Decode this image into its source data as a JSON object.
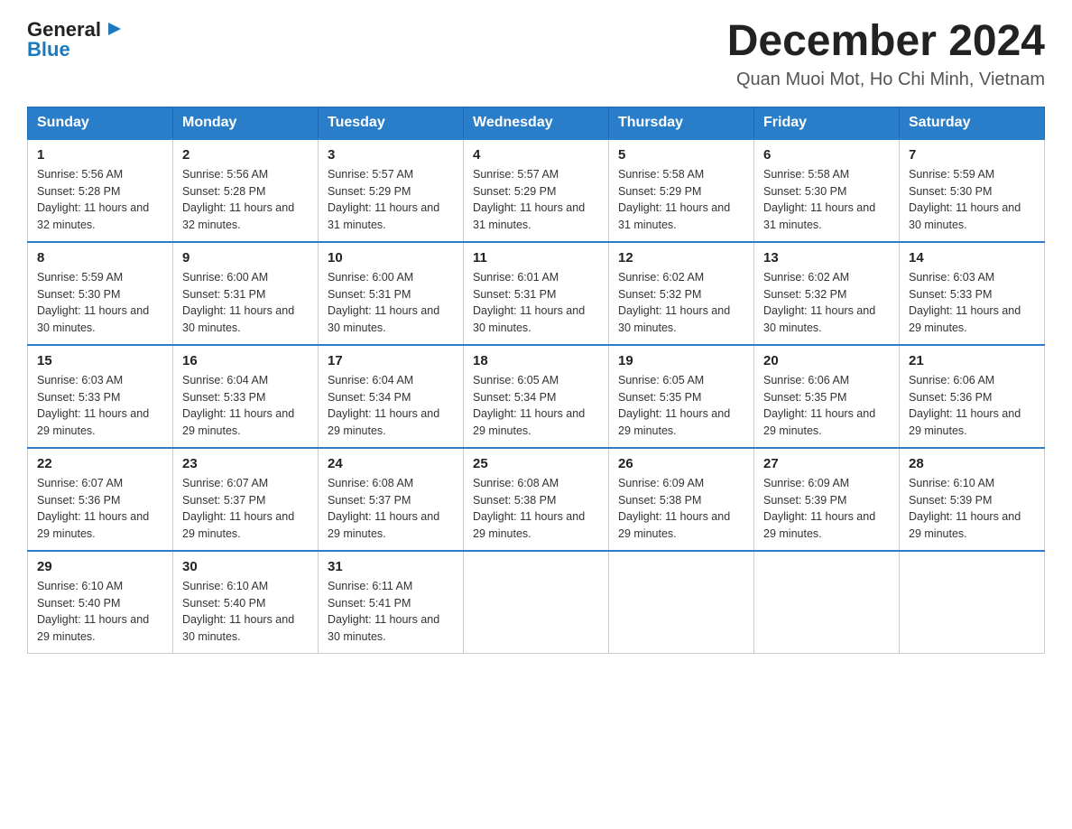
{
  "header": {
    "logo": {
      "general": "General",
      "blue": "Blue",
      "icon": "▶"
    },
    "title": "December 2024",
    "subtitle": "Quan Muoi Mot, Ho Chi Minh, Vietnam"
  },
  "weekdays": [
    "Sunday",
    "Monday",
    "Tuesday",
    "Wednesday",
    "Thursday",
    "Friday",
    "Saturday"
  ],
  "weeks": [
    [
      {
        "day": "1",
        "sunrise": "Sunrise: 5:56 AM",
        "sunset": "Sunset: 5:28 PM",
        "daylight": "Daylight: 11 hours and 32 minutes."
      },
      {
        "day": "2",
        "sunrise": "Sunrise: 5:56 AM",
        "sunset": "Sunset: 5:28 PM",
        "daylight": "Daylight: 11 hours and 32 minutes."
      },
      {
        "day": "3",
        "sunrise": "Sunrise: 5:57 AM",
        "sunset": "Sunset: 5:29 PM",
        "daylight": "Daylight: 11 hours and 31 minutes."
      },
      {
        "day": "4",
        "sunrise": "Sunrise: 5:57 AM",
        "sunset": "Sunset: 5:29 PM",
        "daylight": "Daylight: 11 hours and 31 minutes."
      },
      {
        "day": "5",
        "sunrise": "Sunrise: 5:58 AM",
        "sunset": "Sunset: 5:29 PM",
        "daylight": "Daylight: 11 hours and 31 minutes."
      },
      {
        "day": "6",
        "sunrise": "Sunrise: 5:58 AM",
        "sunset": "Sunset: 5:30 PM",
        "daylight": "Daylight: 11 hours and 31 minutes."
      },
      {
        "day": "7",
        "sunrise": "Sunrise: 5:59 AM",
        "sunset": "Sunset: 5:30 PM",
        "daylight": "Daylight: 11 hours and 30 minutes."
      }
    ],
    [
      {
        "day": "8",
        "sunrise": "Sunrise: 5:59 AM",
        "sunset": "Sunset: 5:30 PM",
        "daylight": "Daylight: 11 hours and 30 minutes."
      },
      {
        "day": "9",
        "sunrise": "Sunrise: 6:00 AM",
        "sunset": "Sunset: 5:31 PM",
        "daylight": "Daylight: 11 hours and 30 minutes."
      },
      {
        "day": "10",
        "sunrise": "Sunrise: 6:00 AM",
        "sunset": "Sunset: 5:31 PM",
        "daylight": "Daylight: 11 hours and 30 minutes."
      },
      {
        "day": "11",
        "sunrise": "Sunrise: 6:01 AM",
        "sunset": "Sunset: 5:31 PM",
        "daylight": "Daylight: 11 hours and 30 minutes."
      },
      {
        "day": "12",
        "sunrise": "Sunrise: 6:02 AM",
        "sunset": "Sunset: 5:32 PM",
        "daylight": "Daylight: 11 hours and 30 minutes."
      },
      {
        "day": "13",
        "sunrise": "Sunrise: 6:02 AM",
        "sunset": "Sunset: 5:32 PM",
        "daylight": "Daylight: 11 hours and 30 minutes."
      },
      {
        "day": "14",
        "sunrise": "Sunrise: 6:03 AM",
        "sunset": "Sunset: 5:33 PM",
        "daylight": "Daylight: 11 hours and 29 minutes."
      }
    ],
    [
      {
        "day": "15",
        "sunrise": "Sunrise: 6:03 AM",
        "sunset": "Sunset: 5:33 PM",
        "daylight": "Daylight: 11 hours and 29 minutes."
      },
      {
        "day": "16",
        "sunrise": "Sunrise: 6:04 AM",
        "sunset": "Sunset: 5:33 PM",
        "daylight": "Daylight: 11 hours and 29 minutes."
      },
      {
        "day": "17",
        "sunrise": "Sunrise: 6:04 AM",
        "sunset": "Sunset: 5:34 PM",
        "daylight": "Daylight: 11 hours and 29 minutes."
      },
      {
        "day": "18",
        "sunrise": "Sunrise: 6:05 AM",
        "sunset": "Sunset: 5:34 PM",
        "daylight": "Daylight: 11 hours and 29 minutes."
      },
      {
        "day": "19",
        "sunrise": "Sunrise: 6:05 AM",
        "sunset": "Sunset: 5:35 PM",
        "daylight": "Daylight: 11 hours and 29 minutes."
      },
      {
        "day": "20",
        "sunrise": "Sunrise: 6:06 AM",
        "sunset": "Sunset: 5:35 PM",
        "daylight": "Daylight: 11 hours and 29 minutes."
      },
      {
        "day": "21",
        "sunrise": "Sunrise: 6:06 AM",
        "sunset": "Sunset: 5:36 PM",
        "daylight": "Daylight: 11 hours and 29 minutes."
      }
    ],
    [
      {
        "day": "22",
        "sunrise": "Sunrise: 6:07 AM",
        "sunset": "Sunset: 5:36 PM",
        "daylight": "Daylight: 11 hours and 29 minutes."
      },
      {
        "day": "23",
        "sunrise": "Sunrise: 6:07 AM",
        "sunset": "Sunset: 5:37 PM",
        "daylight": "Daylight: 11 hours and 29 minutes."
      },
      {
        "day": "24",
        "sunrise": "Sunrise: 6:08 AM",
        "sunset": "Sunset: 5:37 PM",
        "daylight": "Daylight: 11 hours and 29 minutes."
      },
      {
        "day": "25",
        "sunrise": "Sunrise: 6:08 AM",
        "sunset": "Sunset: 5:38 PM",
        "daylight": "Daylight: 11 hours and 29 minutes."
      },
      {
        "day": "26",
        "sunrise": "Sunrise: 6:09 AM",
        "sunset": "Sunset: 5:38 PM",
        "daylight": "Daylight: 11 hours and 29 minutes."
      },
      {
        "day": "27",
        "sunrise": "Sunrise: 6:09 AM",
        "sunset": "Sunset: 5:39 PM",
        "daylight": "Daylight: 11 hours and 29 minutes."
      },
      {
        "day": "28",
        "sunrise": "Sunrise: 6:10 AM",
        "sunset": "Sunset: 5:39 PM",
        "daylight": "Daylight: 11 hours and 29 minutes."
      }
    ],
    [
      {
        "day": "29",
        "sunrise": "Sunrise: 6:10 AM",
        "sunset": "Sunset: 5:40 PM",
        "daylight": "Daylight: 11 hours and 29 minutes."
      },
      {
        "day": "30",
        "sunrise": "Sunrise: 6:10 AM",
        "sunset": "Sunset: 5:40 PM",
        "daylight": "Daylight: 11 hours and 30 minutes."
      },
      {
        "day": "31",
        "sunrise": "Sunrise: 6:11 AM",
        "sunset": "Sunset: 5:41 PM",
        "daylight": "Daylight: 11 hours and 30 minutes."
      },
      null,
      null,
      null,
      null
    ]
  ]
}
